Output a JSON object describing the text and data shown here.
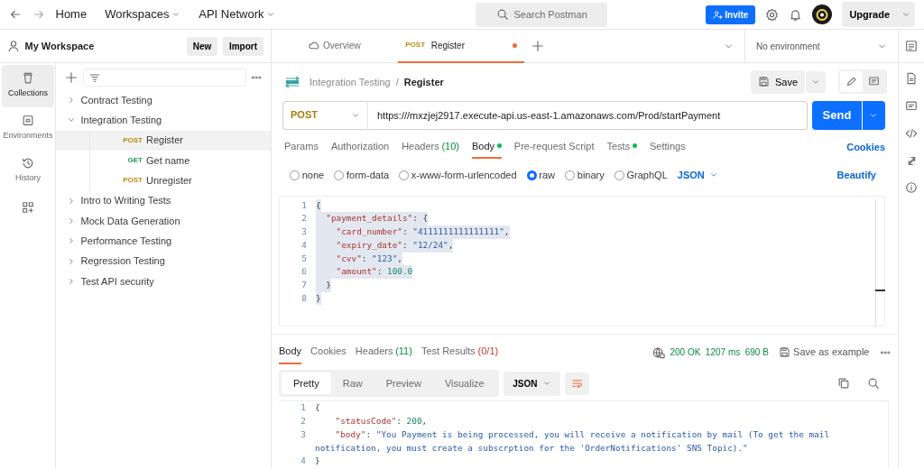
{
  "topbar": {
    "nav": [
      "Home",
      "Workspaces",
      "API Network"
    ],
    "search": {
      "placeholder": "Search Postman"
    },
    "invite": "Invite",
    "upgrade": "Upgrade"
  },
  "workspace": {
    "title": "My Workspace",
    "buttons": [
      "New",
      "Import"
    ]
  },
  "rail": [
    {
      "label": "Collections",
      "selected": true
    },
    {
      "label": "Environments",
      "selected": false
    },
    {
      "label": "History",
      "selected": false
    }
  ],
  "collections": [
    {
      "name": "Contract Testing",
      "expanded": false
    },
    {
      "name": "Integration Testing",
      "expanded": true,
      "children": [
        {
          "method": "POST",
          "color": "#b78a10",
          "name": "Register",
          "selected": true
        },
        {
          "method": "GET",
          "color": "#1f9a54",
          "name": "Get name",
          "selected": false
        },
        {
          "method": "POST",
          "color": "#b78a10",
          "name": "Unregister",
          "selected": false
        }
      ]
    },
    {
      "name": "Intro to Writing Tests",
      "expanded": false
    },
    {
      "name": "Mock Data Generation",
      "expanded": false
    },
    {
      "name": "Performance Testing",
      "expanded": false
    },
    {
      "name": "Regression Testing",
      "expanded": false
    },
    {
      "name": "Test API security",
      "expanded": false
    }
  ],
  "tabs": [
    {
      "label": "Overview",
      "selected": false
    },
    {
      "method": "POST",
      "label": "Register",
      "selected": true,
      "unsaved": true
    }
  ],
  "environment": "No environment",
  "breadcrumb": {
    "parent": "Integration Testing",
    "separator": "/",
    "current": "Register"
  },
  "mode_toggle": [
    {
      "kind": "edit",
      "selected": true
    },
    {
      "kind": "comment",
      "selected": false
    }
  ],
  "save": "Save",
  "request": {
    "method": "POST",
    "url": "https:///mxzjej2917.execute-api.us-east-1.amazonaws.com/Prod/startPayment",
    "send": "Send"
  },
  "request_tabs": [
    {
      "label": "Params",
      "selected": false
    },
    {
      "label": "Authorization",
      "selected": false
    },
    {
      "label": "Headers",
      "count": "(10)",
      "selected": false
    },
    {
      "label": "Body",
      "dot": true,
      "selected": true
    },
    {
      "label": "Pre-request Script",
      "selected": false
    },
    {
      "label": "Tests",
      "dot": true,
      "selected": false
    },
    {
      "label": "Settings",
      "selected": false
    }
  ],
  "cookies_link": "Cookies",
  "body_types": [
    {
      "label": "none",
      "selected": false
    },
    {
      "label": "form-data",
      "selected": false
    },
    {
      "label": "x-www-form-urlencoded",
      "selected": false
    },
    {
      "label": "raw",
      "selected": true
    },
    {
      "label": "binary",
      "selected": false
    },
    {
      "label": "GraphQL",
      "selected": false
    }
  ],
  "body_format": "JSON",
  "beautify": "Beautify",
  "request_body": [
    {
      "number": "1",
      "tokens": [
        {
          "kind": "punct",
          "text": "{"
        }
      ]
    },
    {
      "number": "2",
      "tokens": [
        {
          "kind": "key",
          "text": "  \"payment_details\""
        },
        {
          "kind": "punct",
          "text": ": {"
        }
      ]
    },
    {
      "number": "3",
      "tokens": [
        {
          "kind": "key",
          "text": "    \"card_number\""
        },
        {
          "kind": "punct",
          "text": ": "
        },
        {
          "kind": "string",
          "text": "\"4111111111111111\""
        },
        {
          "kind": "punct",
          "text": ","
        }
      ]
    },
    {
      "number": "4",
      "tokens": [
        {
          "kind": "key",
          "text": "    \"expiry_date\""
        },
        {
          "kind": "punct",
          "text": ": "
        },
        {
          "kind": "string",
          "text": "\"12/24\""
        },
        {
          "kind": "punct",
          "text": ","
        }
      ]
    },
    {
      "number": "5",
      "tokens": [
        {
          "kind": "key",
          "text": "    \"cvv\""
        },
        {
          "kind": "punct",
          "text": ": "
        },
        {
          "kind": "string",
          "text": "\"123\""
        },
        {
          "kind": "punct",
          "text": ","
        }
      ]
    },
    {
      "number": "6",
      "tokens": [
        {
          "kind": "key",
          "text": "    \"amount\""
        },
        {
          "kind": "punct",
          "text": ": "
        },
        {
          "kind": "number",
          "text": "100.0"
        }
      ]
    },
    {
      "number": "7",
      "tokens": [
        {
          "kind": "punct",
          "text": "  }"
        }
      ]
    },
    {
      "number": "8",
      "tokens": [
        {
          "kind": "punct",
          "text": "}"
        }
      ]
    }
  ],
  "response_tabs": [
    {
      "label": "Body",
      "selected": true
    },
    {
      "label": "Cookies",
      "selected": false
    },
    {
      "label": "Headers",
      "count": "(11)",
      "selected": false
    },
    {
      "label": "Test Results",
      "count": "(0/1)",
      "selected": false
    }
  ],
  "response_status": {
    "status": "200 OK",
    "time": "1207 ms",
    "size": "690 B",
    "save_example": "Save as example"
  },
  "view_modes": [
    {
      "label": "Pretty",
      "selected": true
    },
    {
      "label": "Raw",
      "selected": false
    },
    {
      "label": "Preview",
      "selected": false
    },
    {
      "label": "Visualize",
      "selected": false
    }
  ],
  "response_format": "JSON",
  "response_body": [
    {
      "number": "1",
      "tokens": [
        {
          "kind": "punct",
          "text": "{"
        }
      ]
    },
    {
      "number": "2",
      "tokens": [
        {
          "kind": "key",
          "text": "    \"statusCode\""
        },
        {
          "kind": "punct",
          "text": ": "
        },
        {
          "kind": "number",
          "text": "200"
        },
        {
          "kind": "punct",
          "text": ","
        }
      ]
    },
    {
      "number": "3",
      "tokens": [
        {
          "kind": "key",
          "text": "    \"body\""
        },
        {
          "kind": "punct",
          "text": ": "
        },
        {
          "kind": "string",
          "text": "\"You Payment is being processed, you will receive a notification by mail (To get the mail notification, you must create a subscrption for the 'OrderNotifications' SNS Topic).\""
        }
      ]
    },
    {
      "number": "4",
      "tokens": [
        {
          "kind": "punct",
          "text": "}"
        }
      ]
    }
  ]
}
